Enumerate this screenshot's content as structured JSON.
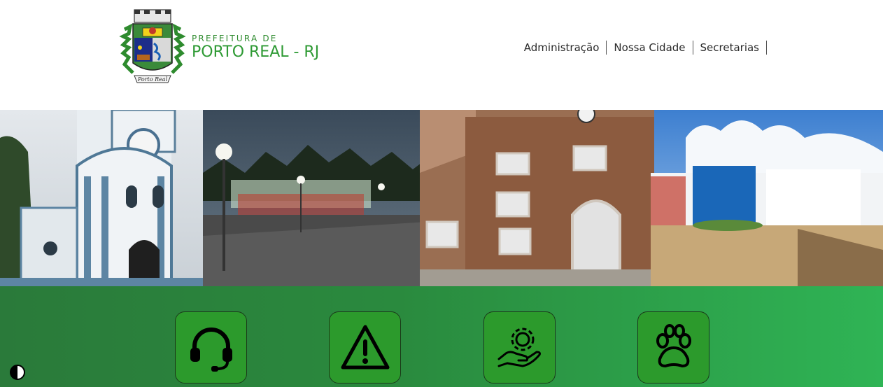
{
  "header": {
    "brand_small": "PREFEITURA DE",
    "brand_big": "PORTO REAL - RJ",
    "logo_caption": "Porto Real"
  },
  "nav": {
    "items": [
      {
        "label": "Administração"
      },
      {
        "label": "Nossa Cidade"
      },
      {
        "label": "Secretarias"
      }
    ]
  },
  "services": {
    "items": [
      {
        "icon": "headset-icon"
      },
      {
        "icon": "warning-icon"
      },
      {
        "icon": "gear-hand-icon"
      },
      {
        "icon": "paw-icon"
      }
    ]
  },
  "accessibility": {
    "icon": "contrast-icon"
  },
  "colors": {
    "brand_green": "#2e9a34",
    "strip_start": "#2a7a3a",
    "strip_end": "#2fb455",
    "tile": "#2c9a2c"
  }
}
